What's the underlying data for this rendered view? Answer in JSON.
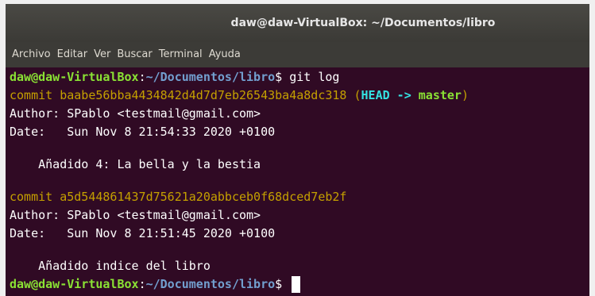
{
  "window": {
    "title": "daw@daw-VirtualBox: ~/Documentos/libro"
  },
  "menu": {
    "items": [
      "Archivo",
      "Editar",
      "Ver",
      "Buscar",
      "Terminal",
      "Ayuda"
    ]
  },
  "prompt": {
    "user_host": "daw@daw-VirtualBox",
    "separator": ":",
    "path": "~/Documentos/libro",
    "symbol": "$"
  },
  "command": " git log",
  "log": [
    {
      "commit_text": "commit baabe56bba4434842d4d7d7eb26543ba4a8dc318",
      "ref_open": " (",
      "ref_head": "HEAD -> ",
      "ref_branch": "master",
      "ref_close": ")",
      "author_line": "Author: SPablo <testmail@gmail.com>",
      "date_line": "Date:   Sun Nov 8 21:54:33 2020 +0100",
      "message": "    Añadido 4: La bella y la bestia"
    },
    {
      "commit_text": "commit a5d544861437d75621a20abbceb0f68dced7eb2f",
      "author_line": "Author: SPablo <testmail@gmail.com>",
      "date_line": "Date:   Sun Nov 8 21:51:45 2020 +0100",
      "message": "    Añadido indice del libro"
    }
  ],
  "colors": {
    "background": "#300a24",
    "user_host": "#8ae234",
    "path": "#729fcf",
    "commit": "#c4a000",
    "head": "#34e2e2",
    "branch": "#8ae234"
  }
}
